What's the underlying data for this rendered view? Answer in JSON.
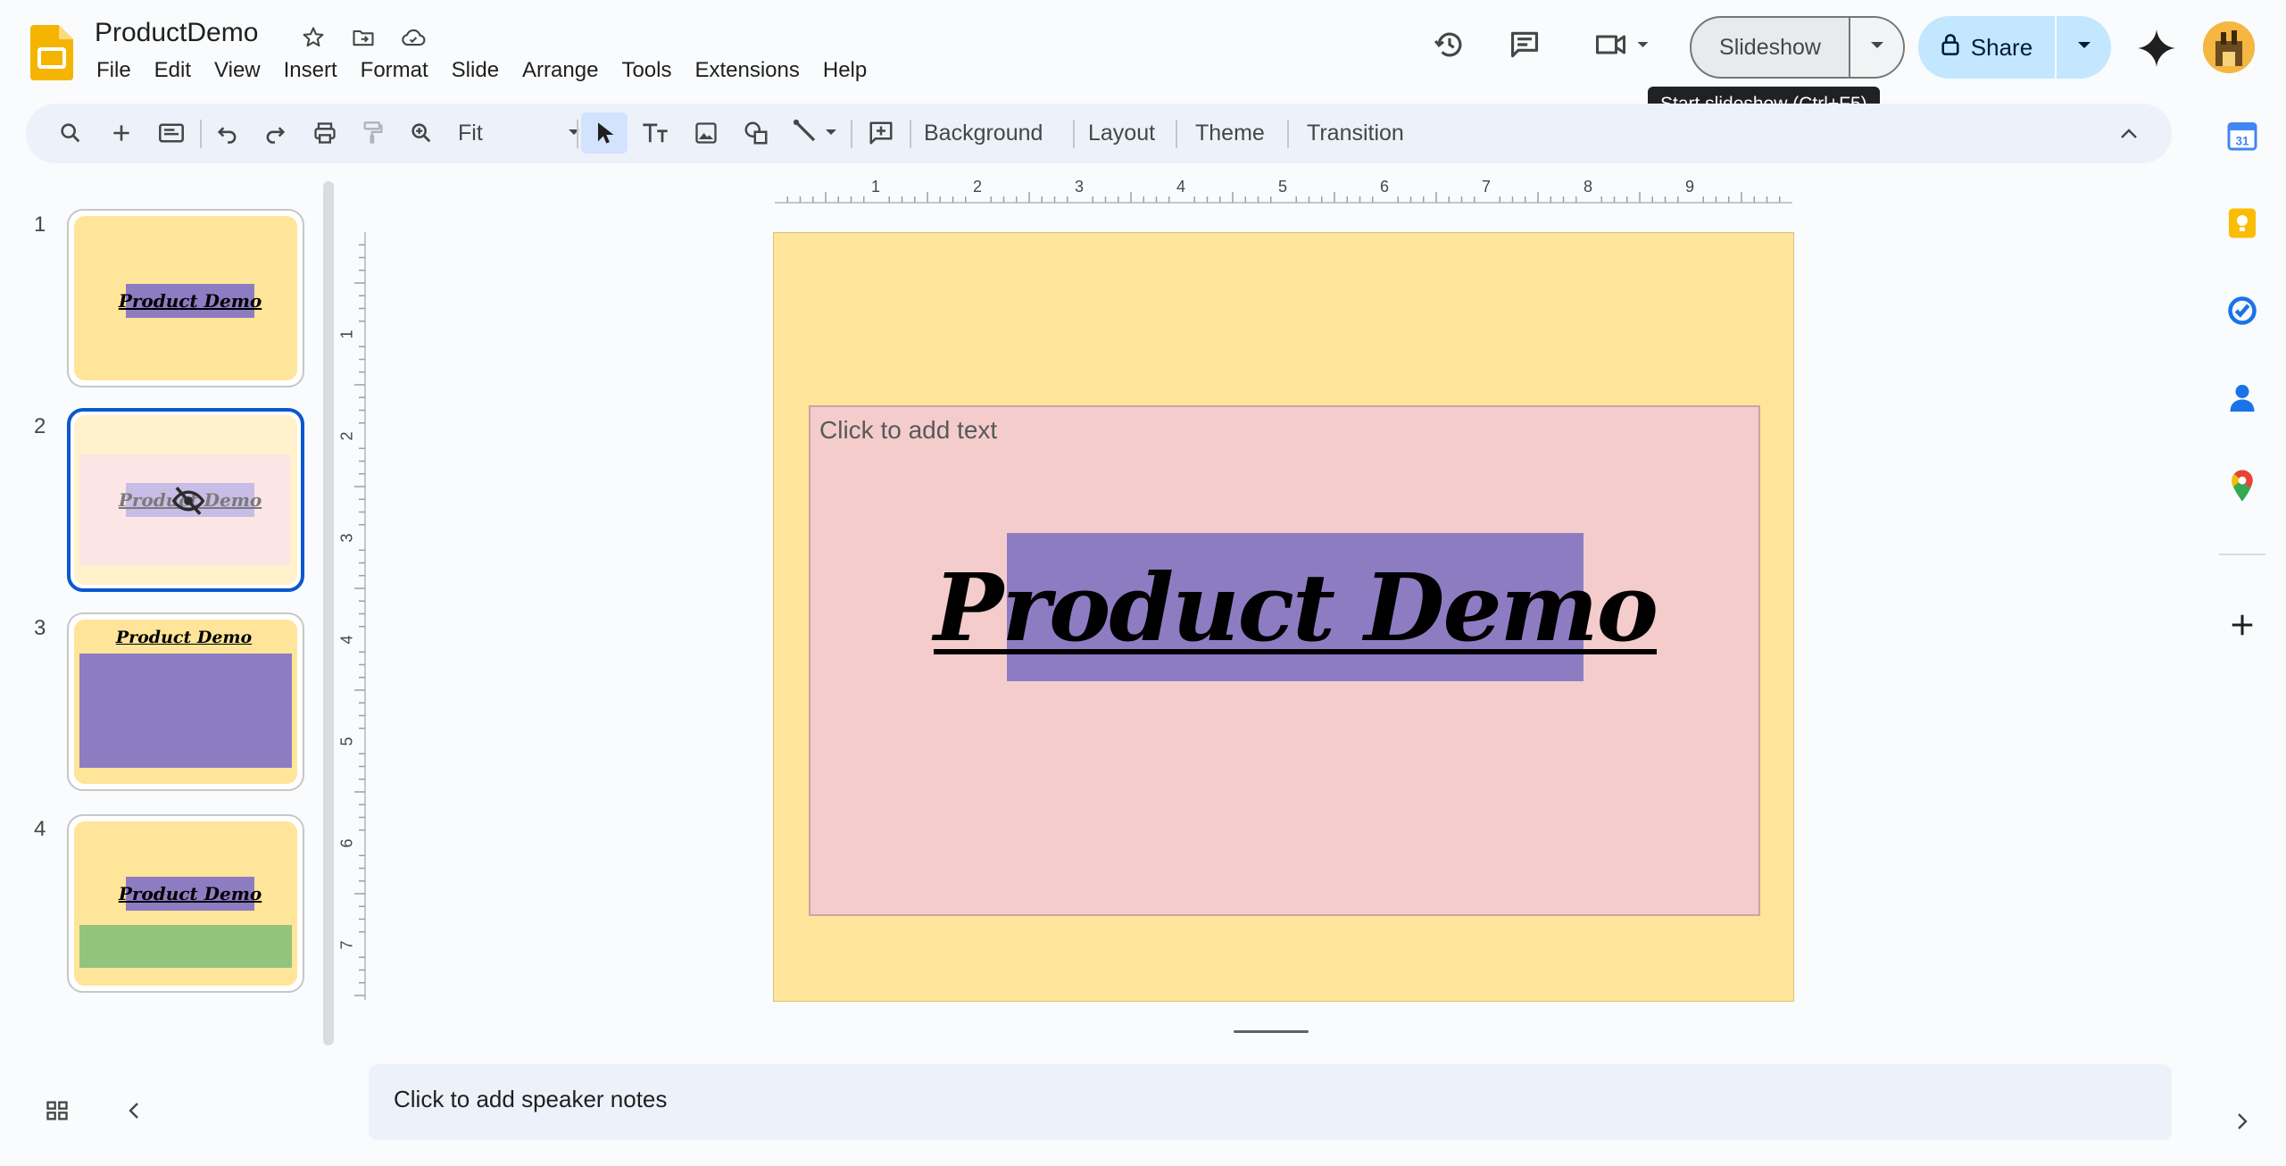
{
  "doc": {
    "title": "ProductDemo"
  },
  "menu": [
    "File",
    "Edit",
    "View",
    "Insert",
    "Format",
    "Slide",
    "Arrange",
    "Tools",
    "Extensions",
    "Help"
  ],
  "header": {
    "slideshow_label": "Slideshow",
    "share_label": "Share",
    "tooltip": "Start slideshow (Ctrl+F5)"
  },
  "toolbar": {
    "zoom_value": "Fit",
    "background_label": "Background",
    "layout_label": "Layout",
    "theme_label": "Theme",
    "transition_label": "Transition"
  },
  "filmstrip": {
    "slides": [
      {
        "number": "1",
        "title": "Product Demo"
      },
      {
        "number": "2",
        "title": "Product Demo"
      },
      {
        "number": "3",
        "title": "Product Demo"
      },
      {
        "number": "4",
        "title": "Product Demo"
      }
    ]
  },
  "ruler": {
    "horizontal": [
      "1",
      "2",
      "3",
      "4",
      "5",
      "6",
      "7",
      "8",
      "9"
    ],
    "vertical": [
      "1",
      "2",
      "3",
      "4",
      "5",
      "6",
      "7"
    ]
  },
  "slide": {
    "placeholder": "Click to add text",
    "title": "Product Demo"
  },
  "notes": {
    "placeholder": "Click to add speaker notes"
  },
  "colors": {
    "slide_background": "#ffe599",
    "textbox_fill": "#f4cccc",
    "title_fill": "#8e7cc3",
    "green_block": "#93c47d",
    "selection_blue": "#0b57d0",
    "share_button": "#c2e7ff"
  },
  "icons": [
    "slides-logo",
    "star-icon",
    "move-to-folder-icon",
    "cloud-saved-icon",
    "version-history-icon",
    "comments-icon",
    "meet-icon",
    "lock-icon",
    "gemini-icon",
    "search-icon",
    "new-slide-icon",
    "undo-icon",
    "redo-icon",
    "print-icon",
    "paint-format-icon",
    "zoom-icon",
    "select-icon",
    "text-box-icon",
    "image-icon",
    "shape-icon",
    "line-icon",
    "comment-add-icon",
    "collapse-toolbar-icon",
    "grid-view-icon",
    "calendar-icon",
    "keep-icon",
    "tasks-icon",
    "contacts-icon",
    "maps-icon",
    "add-icon"
  ]
}
